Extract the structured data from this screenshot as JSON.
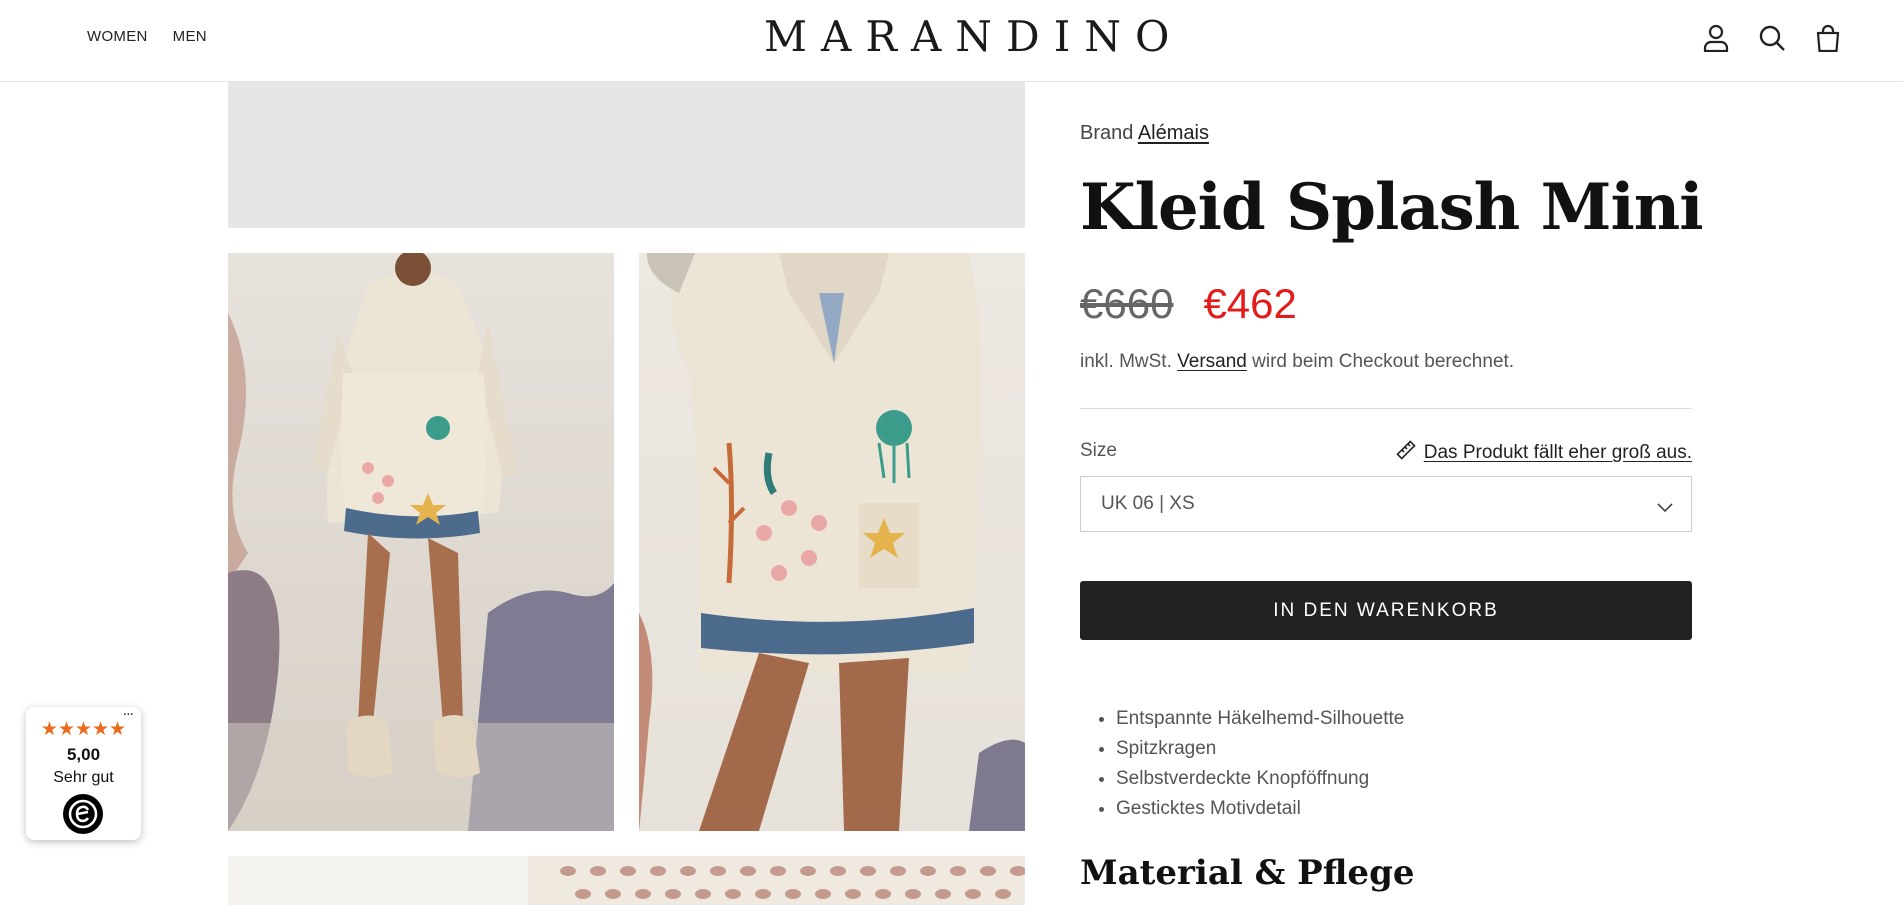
{
  "header": {
    "nav": [
      "WOMEN",
      "MEN"
    ],
    "logo": "MARANDINO",
    "icons": [
      "account-icon",
      "search-icon",
      "bag-icon"
    ]
  },
  "product": {
    "brand_prefix": "Brand",
    "brand_name": "Alémais",
    "title": "Kleid Splash Mini",
    "old_price": "€660",
    "new_price": "€462",
    "tax_prefix": "inkl. MwSt.",
    "tax_link": "Versand",
    "tax_suffix": "wird beim Checkout berechnet.",
    "size_label": "Size",
    "fit_note": "Das Produkt fällt eher groß aus.",
    "size_selected": "UK 06 | XS",
    "add_to_cart": "IN DEN WARENKORB",
    "features": [
      "Entspannte Häkelhemd-Silhouette",
      "Spitzkragen",
      "Selbstverdeckte Knopföffnung",
      "Gesticktes Motivdetail"
    ],
    "section_heading": "Material & Pflege"
  },
  "badge": {
    "stars": "★★★★★",
    "score": "5,00",
    "label": "Sehr gut",
    "menu": "···"
  },
  "colors": {
    "sale": "#e31b1b",
    "button": "#222222",
    "stars": "#e86c1f"
  }
}
